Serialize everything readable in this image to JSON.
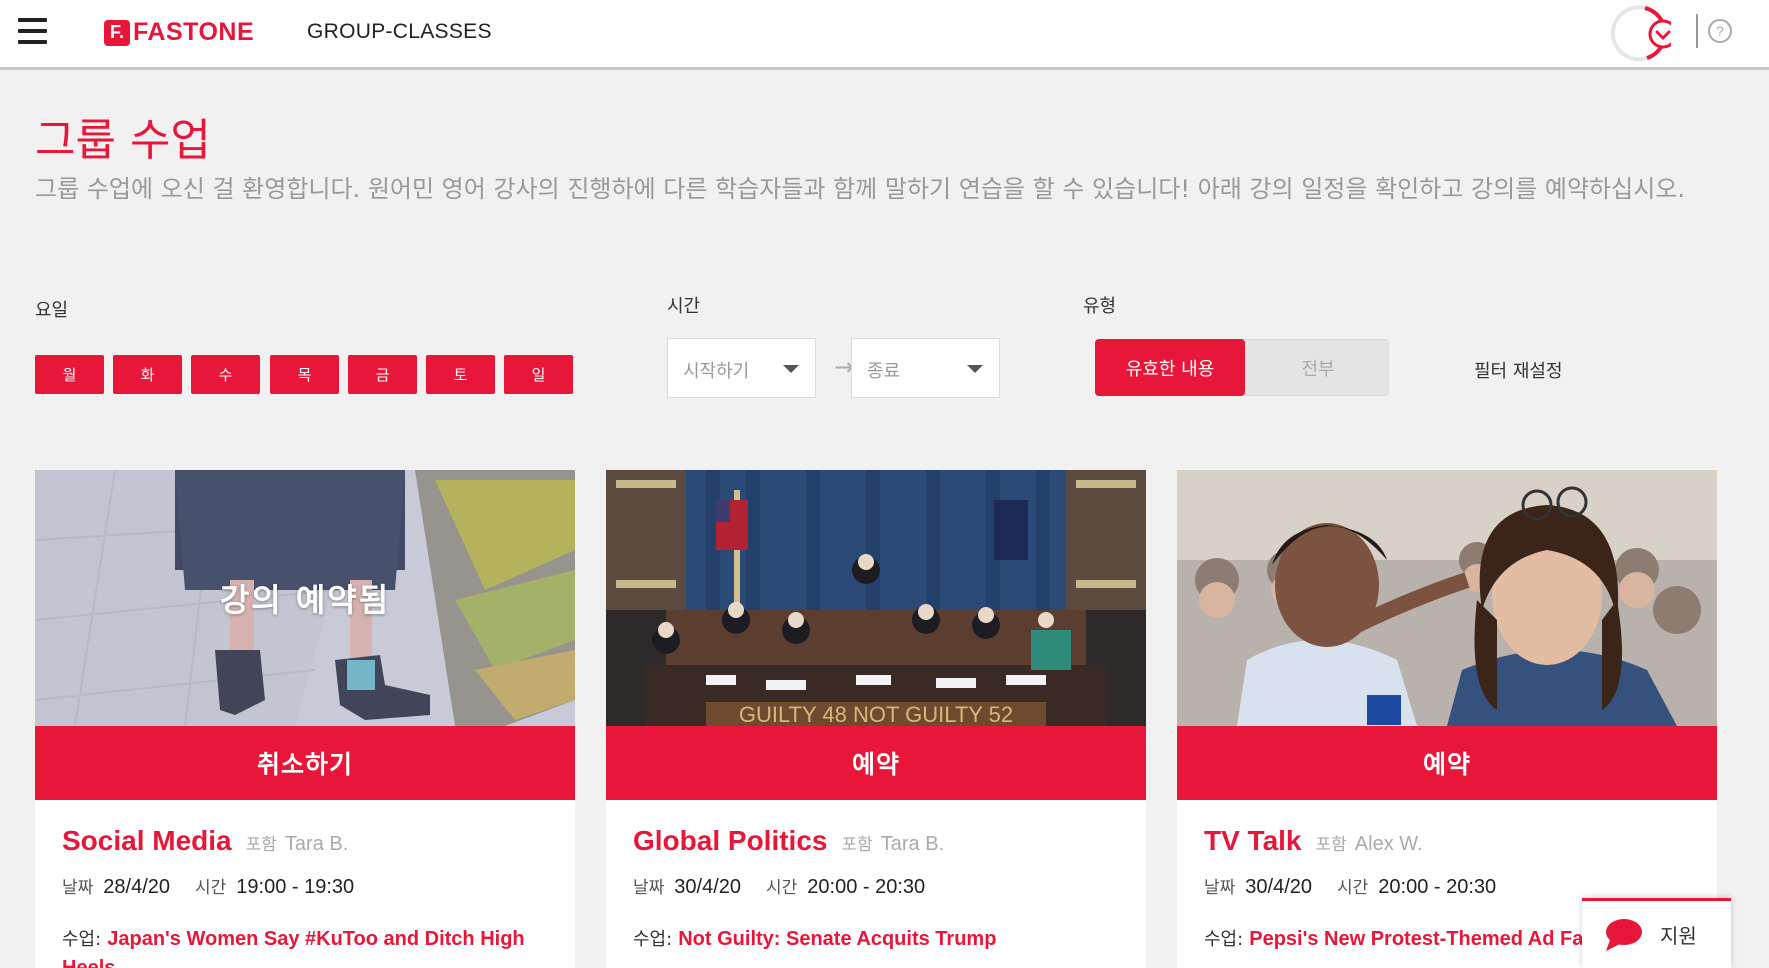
{
  "header": {
    "logo_mark": "F.",
    "logo_text": "FASTONE",
    "nav_title": "GROUP-CLASSES",
    "help_glyph": "?"
  },
  "page": {
    "title": "그룹 수업",
    "intro": "그룹 수업에 오신 걸 환영합니다. 원어민 영어 강사의 진행하에 다른 학습자들과 함께 말하기 연습을 할 수 있습니다! 아래 강의 일정을 확인하고 강의를 예약하십시오."
  },
  "filters": {
    "days_label": "요일",
    "days": [
      "월",
      "화",
      "수",
      "목",
      "금",
      "토",
      "일"
    ],
    "time_label": "시간",
    "time_start_placeholder": "시작하기",
    "time_end_placeholder": "종료",
    "type_label": "유형",
    "type_active": "유효한 내용",
    "type_all": "전부",
    "reset": "필터 재설정"
  },
  "accent_color": "#e8173a",
  "cards": [
    {
      "title": "Social Media",
      "with_label": "포함",
      "teacher": "Tara B.",
      "date_label": "날짜",
      "date": "28/4/20",
      "time_label": "시간",
      "time": "19:00 - 19:30",
      "class_label": "수업:",
      "class_title": "Japan's Women Say #KuToo and Ditch High Heels",
      "overlay": "강의 예약됨",
      "action": "취소하기"
    },
    {
      "title": "Global Politics",
      "with_label": "포함",
      "teacher": "Tara B.",
      "date_label": "날짜",
      "date": "30/4/20",
      "time_label": "시간",
      "time": "20:00 - 20:30",
      "class_label": "수업:",
      "class_title": "Not Guilty: Senate Acquits Trump",
      "image_caption": "GUILTY 48 NOT GUILTY 52",
      "action": "예약"
    },
    {
      "title": "TV Talk",
      "with_label": "포함",
      "teacher": "Alex W.",
      "date_label": "날짜",
      "date": "30/4/20",
      "time_label": "시간",
      "time": "20:00 - 20:30",
      "class_label": "수업:",
      "class_title": "Pepsi's New Protest-Themed Ad Fails",
      "action": "예약"
    }
  ],
  "support": {
    "icon": "chat-bubble-icon",
    "label": "지원"
  }
}
